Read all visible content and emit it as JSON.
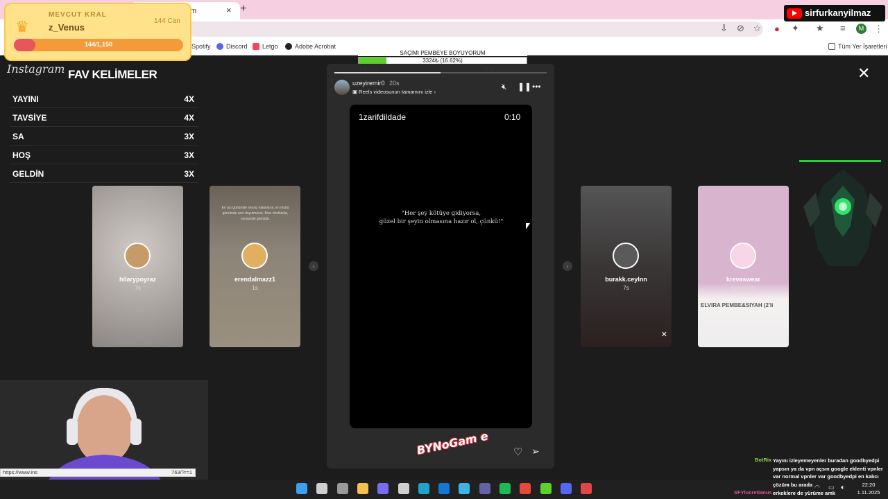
{
  "browser": {
    "tab_title_fragment": "m",
    "new_tab_symbol": "+",
    "tab_close_symbol": "×",
    "bookmarks": [
      {
        "label": "Spotify",
        "color": "#1db954"
      },
      {
        "label": "Discord",
        "color": "#5865f2"
      },
      {
        "label": "Letgo",
        "color": "#ff3f55"
      },
      {
        "label": "Adobe Acrobat",
        "color": "#222222"
      }
    ],
    "all_bookmarks_label": "Tüm Yer İşaretleri",
    "profile_initial": "M"
  },
  "king_widget": {
    "label": "MEVCUT KRAL",
    "name": "z_Venus",
    "coins": "144 Can",
    "progress_text": "144/1,150",
    "progress_fraction": 0.125
  },
  "fav_words": {
    "instagram_label": "Instagram",
    "title": "FAV KELİMELER",
    "rows": [
      {
        "word": "YAYINI",
        "count": "4X"
      },
      {
        "word": "TAVSİYE",
        "count": "4X"
      },
      {
        "word": "SA",
        "count": "3X"
      },
      {
        "word": "HOŞ",
        "count": "3X"
      },
      {
        "word": "GELDİN",
        "count": "3X"
      }
    ]
  },
  "goal": {
    "title": "SAÇIMI PEMBEYE BOYUYORUM",
    "progress_text": "3324₺ (16.62%)",
    "progress_fraction": 0.1662,
    "min_label": "TRY0",
    "max_label": "TRY20000"
  },
  "story": {
    "username": "uzeyiremir0",
    "time_ago": "20s",
    "reels_link": "Reels videosunun tamamını izle",
    "video_handle": "1zarifdildade",
    "video_timer": "0:10",
    "quote_line1": "\"Her şey kötüye gidiyorsa,",
    "quote_line2": "güzel bir şeyin olmasına hazır ol, çünkü!\"",
    "watermark": "BYNoGam e",
    "progress_fraction": 0.5
  },
  "cards": [
    {
      "name": "hilarypoyraz",
      "time": "7s",
      "bg": "#9a9591",
      "avatar": "#c79a6a"
    },
    {
      "name": "erendalmazz1",
      "time": "1s",
      "bg": "#8c8478",
      "avatar": "#e0b060",
      "caption": "En acı günümde sessiz kalanların, en mutlu günümde sesi duyulmasın. Bazı dostluklar, cenazede gömülür."
    },
    {
      "name": "burakk.ceylnn",
      "time": "7s",
      "bg": "#3a3636",
      "avatar": "#5a5a5a"
    },
    {
      "name": "krevaswear",
      "time": "Sponsorlu",
      "bg": "#d8b4cf",
      "avatar": "#f7d6e6",
      "banner": "ELVIRA PEMBE&SIYAH (2'li"
    }
  ],
  "status_url": {
    "left": "https://www.ins",
    "right": "763/?r=1"
  },
  "channel": {
    "name": "sirfurkanyilmaz"
  },
  "chat": [
    {
      "user": "BotRix",
      "user_color": "#8fd14f",
      "lines": [
        "Yayını izleyemeyenler buradan goodbyedpi",
        "yapsın ya da vpn açsın google eklenti vpnler",
        "var normal vpnler var goodbyedpi en kalıcı",
        "çözüm bu arada"
      ]
    },
    {
      "user": "SFYlucretianus",
      "user_color": "#e0559a",
      "lines": [
        "erkeklere de yürüme amk"
      ]
    }
  ],
  "clock": {
    "time": "22:20",
    "date": "1.11.2025"
  },
  "taskbar_icons": [
    {
      "name": "windows-start",
      "color": "#3aa0f0"
    },
    {
      "name": "search",
      "color": "#cfcfcf"
    },
    {
      "name": "task-view",
      "color": "#9a9a9a"
    },
    {
      "name": "file-explorer",
      "color": "#f2c14e"
    },
    {
      "name": "copilot",
      "color": "#7a6cf0"
    },
    {
      "name": "store",
      "color": "#d0d0d0"
    },
    {
      "name": "edge",
      "color": "#1fa5c9"
    },
    {
      "name": "outlook",
      "color": "#1477d4"
    },
    {
      "name": "photos",
      "color": "#3cb4e6"
    },
    {
      "name": "teams",
      "color": "#6264a7"
    },
    {
      "name": "spotify",
      "color": "#1db954"
    },
    {
      "name": "chrome",
      "color": "#e84a3a"
    },
    {
      "name": "media",
      "color": "#5bd12a"
    },
    {
      "name": "discord",
      "color": "#5865f2"
    },
    {
      "name": "obs",
      "color": "#e04848"
    }
  ]
}
